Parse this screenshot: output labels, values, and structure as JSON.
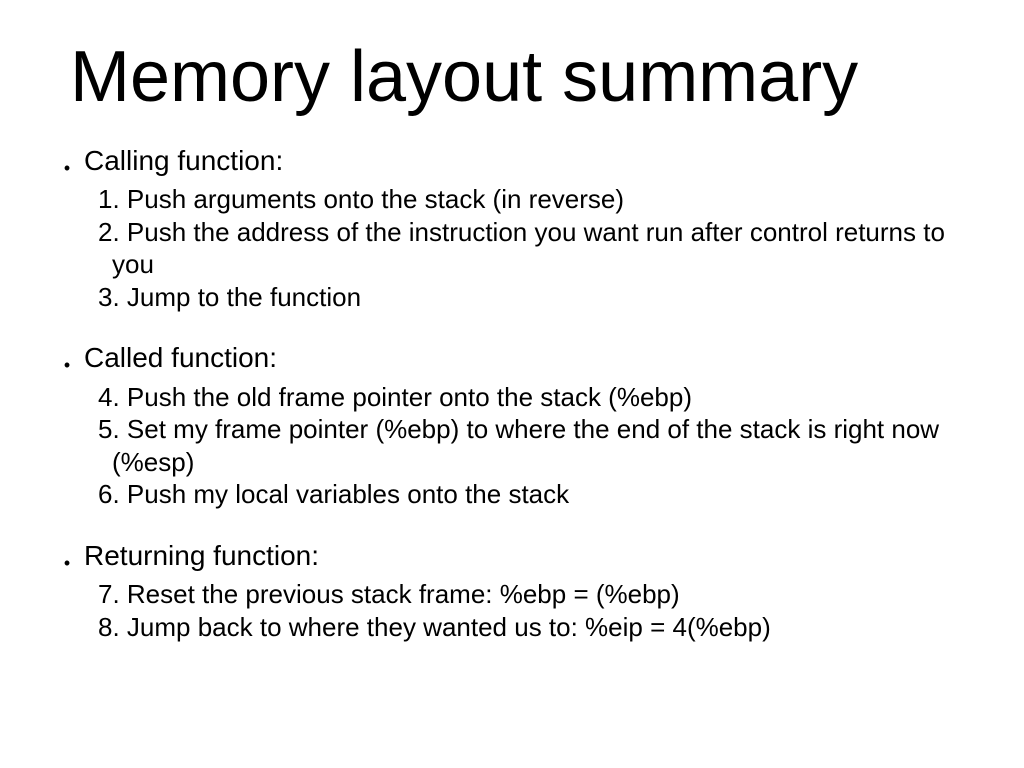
{
  "title": "Memory layout summary",
  "sections": [
    {
      "heading": "Calling function:",
      "lines": [
        "1. Push arguments onto the stack (in reverse)",
        "2. Push the address of the instruction you want run after control returns to",
        "you",
        "3. Jump to the function"
      ],
      "cont_indices": [
        2
      ]
    },
    {
      "heading": "Called function:",
      "lines": [
        "4. Push the old frame pointer onto the stack (%ebp)",
        "5. Set my frame pointer (%ebp) to where the end of the stack is right now",
        "(%esp)",
        "6. Push my local variables onto the stack"
      ],
      "cont_indices": [
        2
      ]
    },
    {
      "heading": "Returning function:",
      "lines": [
        "7. Reset the previous stack frame: %ebp = (%ebp)",
        "8. Jump back to where they wanted us to: %eip = 4(%ebp)"
      ],
      "cont_indices": []
    }
  ],
  "bullet_char": "•"
}
